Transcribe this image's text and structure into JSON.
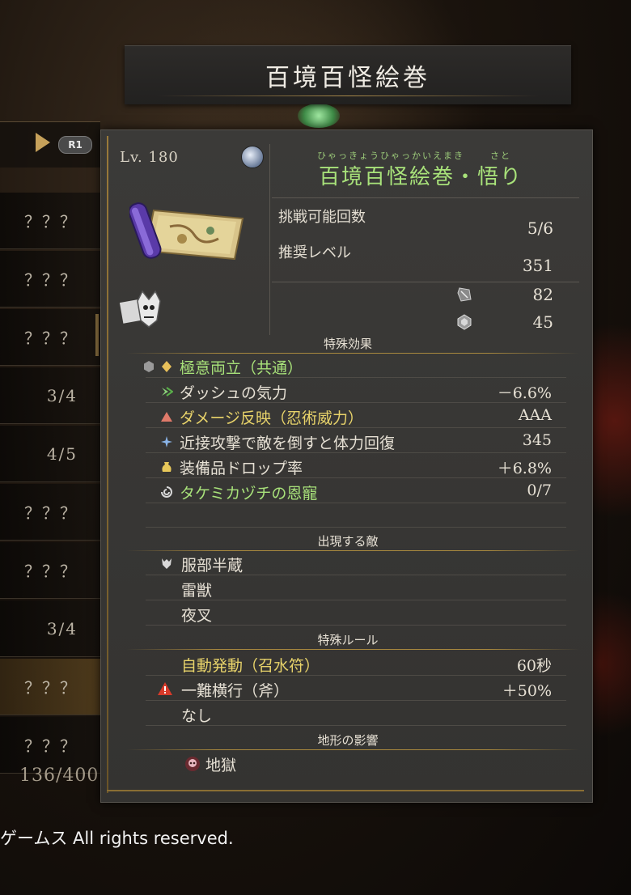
{
  "header": {
    "title": "百境百怪絵巻"
  },
  "left_list": {
    "button_hint": "R1",
    "items": [
      "？？？",
      "？？？",
      "？？？",
      "3/4",
      "4/5",
      "？？？",
      "？？？",
      "3/4",
      "？？？",
      "？？？"
    ],
    "count": "136/400"
  },
  "copyright": "ゲームス All rights reserved.",
  "card": {
    "level": "Lv. 180",
    "name_ruby": "ひゃっきょうひゃっかいえまき",
    "name_ruby_2": "さと",
    "name": "百境百怪絵巻・悟り",
    "stats": [
      {
        "label": "挑戦可能回数",
        "value": "5/6"
      },
      {
        "label": "推奨レベル",
        "value": "351"
      }
    ],
    "materials": [
      {
        "icon": "ore-icon",
        "value": "82"
      },
      {
        "icon": "crystal-icon",
        "value": "45"
      }
    ],
    "special_effects": {
      "title": "特殊効果",
      "rows": [
        {
          "icon": "hex-icon",
          "label": "極意両立（共通）",
          "value": "",
          "color": "#a8e27a"
        },
        {
          "icon": "dash-icon",
          "label": "ダッシュの気力",
          "value": "－6.6%",
          "color": "#e6e0d4"
        },
        {
          "icon": "triangle-icon",
          "label": "ダメージ反映（忍術威力）",
          "value": "AAA",
          "color": "#e8d36a"
        },
        {
          "icon": "sparkle-icon",
          "label": "近接攻撃で敵を倒すと体力回復",
          "value": "345",
          "color": "#e6e0d4"
        },
        {
          "icon": "pouch-icon",
          "label": "装備品ドロップ率",
          "value": "＋6.8%",
          "color": "#e6e0d4"
        },
        {
          "icon": "swirl-icon",
          "label": "タケミカヅチの恩寵",
          "value": "0/7",
          "color": "#a8e27a"
        }
      ]
    },
    "enemies": {
      "title": "出現する敵",
      "rows": [
        "服部半蔵",
        "雷獣",
        "夜叉"
      ]
    },
    "special_rules": {
      "title": "特殊ルール",
      "rows": [
        {
          "label": "自動発動（召水符）",
          "value": "60秒",
          "color": "#e8d36a"
        },
        {
          "label": "一難横行（斧）",
          "value": "＋50%",
          "color": "#e6e0d4"
        },
        {
          "label": "なし",
          "value": "",
          "color": "#e6e0d4"
        }
      ]
    },
    "terrain": {
      "title": "地形の影響",
      "rows": [
        "地獄"
      ]
    }
  }
}
